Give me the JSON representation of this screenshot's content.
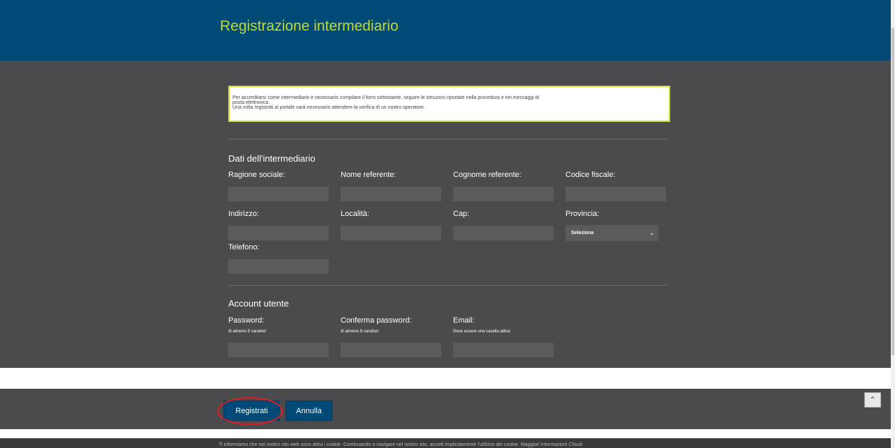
{
  "header": {
    "title": "Registrazione intermediario"
  },
  "notice": {
    "line1": "Per accreditarsi come intermediario è necessario compilare il form sottostante, seguire le istruzioni riportate nella procedura e nei messaggi di",
    "line2": "posta elettronica.",
    "line3": "Una volta registrati al portale sarà necessario attendere la verifica di un nostro operatore."
  },
  "intermediario": {
    "title": "Dati dell'intermediario",
    "ragione_sociale": "Ragione sociale:",
    "nome_referente": "Nome referente:",
    "cognome_referente": "Cognome referente:",
    "codice_fiscale": "Codice fiscale:",
    "indirizzo": "Indirizzo:",
    "localita": "Località:",
    "cap": "Cap:",
    "provincia": "Provincia:",
    "provincia_value": "Seleziona",
    "telefono": "Telefono:"
  },
  "account": {
    "title": "Account utente",
    "password": "Password:",
    "password_hint": "di almeno 8 caratteri",
    "conferma_password": "Conferma password:",
    "conferma_hint": "di almeno 8 caratteri",
    "email": "Email:",
    "email_hint": "Deve essere una casella attiva"
  },
  "buttons": {
    "registrati": "Registrati",
    "annulla": "Annulla"
  },
  "cookie": {
    "text": "Ti informiamo che nel nostro sito web sono attivi i cookie. Continuando a navigare nel nostro sito, accetti implicitamente l'utilizzo dei cookie.   Maggiori informazioni     Chiudi"
  },
  "icons": {
    "select_chevron": "chevron-down-icon",
    "back_to_top": "chevron-up-icon"
  },
  "colors": {
    "header_bg": "#004a77",
    "title": "#bddc2c",
    "body_bg": "#4b4b4d",
    "button_bg": "#004a77",
    "highlight_ring": "#e31b23"
  }
}
